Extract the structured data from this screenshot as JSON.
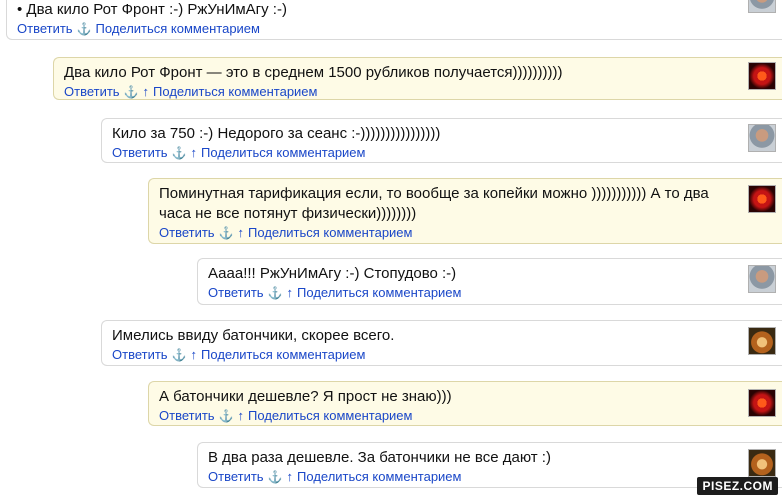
{
  "common": {
    "reply": "Ответить",
    "anchor": "⚓",
    "up": "↑",
    "share": "Поделиться комментарием"
  },
  "comments": [
    {
      "text": "• Два кило Рот Фронт :-) РжУнИмАгу :-)",
      "avatar": "man-avatar"
    },
    {
      "text": "Два кило Рот Фронт — это в среднем 1500 рубликов получается))))))))))",
      "avatar": "red-avatar"
    },
    {
      "text": "Кило за 750 :-) Недорого за сеанс :-))))))))))))))))",
      "avatar": "man-avatar"
    },
    {
      "text": "Поминутная тарификация если, то вообще за копейки можно ))))))))))) А то два часа не все потянут физически))))))))",
      "avatar": "red-avatar"
    },
    {
      "text": "Аааа!!! РжУнИмАгу :-) Стопудово :-)",
      "avatar": "man-avatar"
    },
    {
      "text": "Имелись ввиду батончики, скорее всего.",
      "avatar": "tiger-avatar"
    },
    {
      "text": "А батончики дешевле? Я прост не знаю)))",
      "avatar": "red-avatar"
    },
    {
      "text": "В два раза дешевле. За батончики не все дают :)",
      "avatar": "tiger-avatar"
    }
  ],
  "watermark": "PISEZ.COM"
}
